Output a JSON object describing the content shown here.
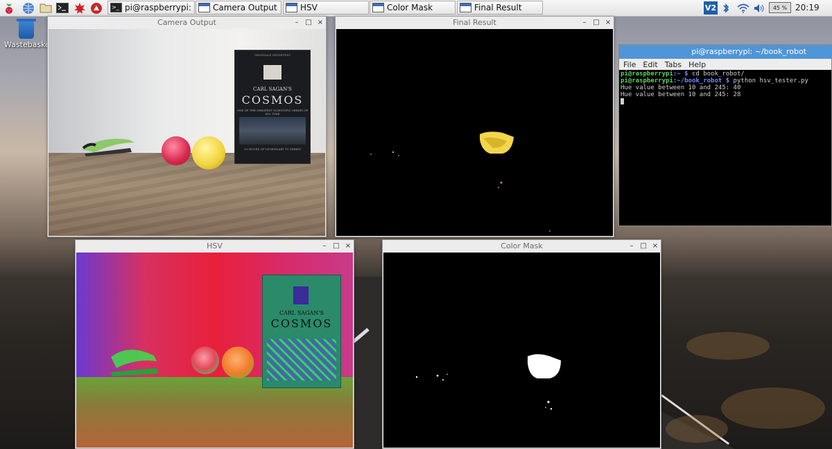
{
  "taskbar": {
    "launchers": [
      {
        "icon": "raspberry-menu-icon"
      },
      {
        "icon": "web-browser-icon"
      },
      {
        "icon": "file-manager-icon"
      },
      {
        "icon": "terminal-icon"
      },
      {
        "icon": "mathematica-icon"
      },
      {
        "icon": "wolfram-icon"
      }
    ],
    "tasks": [
      {
        "label": "pi@raspberrypi: ~/bo...",
        "icon": "terminal-icon"
      },
      {
        "label": "Camera Output",
        "icon": "window-icon"
      },
      {
        "label": "HSV",
        "icon": "window-icon"
      },
      {
        "label": "Color Mask",
        "icon": "window-icon"
      },
      {
        "label": "Final Result",
        "icon": "window-icon"
      }
    ],
    "tray": {
      "vnc_label": "V2",
      "battery": "45 %",
      "clock": "20:19"
    }
  },
  "desktop": {
    "icons": [
      {
        "label": "Wastebasket",
        "icon": "wastebasket-icon"
      }
    ]
  },
  "windows": {
    "camera": {
      "title": "Camera Output"
    },
    "final": {
      "title": "Final Result"
    },
    "hsv": {
      "title": "HSV"
    },
    "mask": {
      "title": "Color Mask"
    }
  },
  "dvd": {
    "top_text": "ORIGINALE SENDETEXT",
    "small": "CARL SAGAN'S",
    "title": "COSMOS",
    "sub": "ONE OF THE GREATEST SCIENTIFIC SERIES OF ALL TIME",
    "bottom": "13 HOURS OF LEGENDARY TV SERIES"
  },
  "terminal": {
    "title": "pi@raspberrypi: ~/book_robot",
    "menu": [
      "File",
      "Edit",
      "Tabs",
      "Help"
    ],
    "lines": [
      {
        "user": "pi@raspberrypi",
        "path": ":~ $",
        "cmd": " cd book_robot/"
      },
      {
        "user": "pi@raspberrypi",
        "path": ":~/book_robot $",
        "cmd": " python hsv_tester.py"
      }
    ],
    "output": [
      "Hue value between 10 and 245: 40",
      "Hue value between 10 and 245: 28"
    ]
  },
  "window_controls": {
    "minimize": "–",
    "maximize": "□",
    "close": "×"
  }
}
